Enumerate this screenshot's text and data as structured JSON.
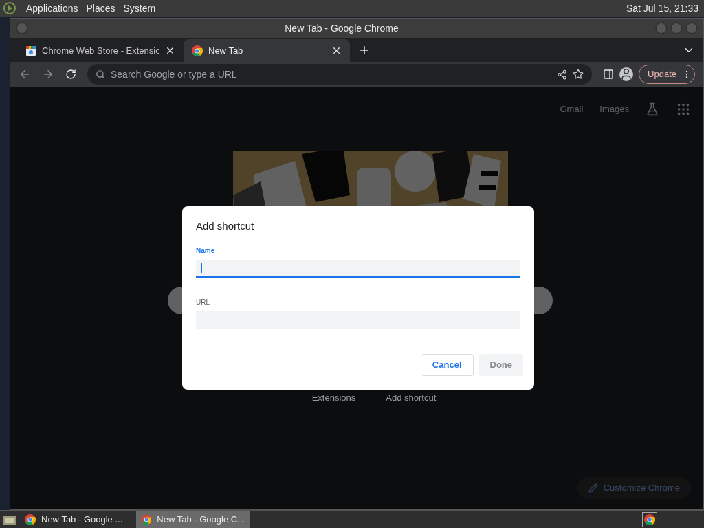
{
  "top_panel": {
    "menus": [
      "Applications",
      "Places",
      "System"
    ],
    "clock": "Sat Jul 15, 21:33"
  },
  "window": {
    "title": "New Tab - Google Chrome"
  },
  "tabs": [
    {
      "label": "Chrome Web Store - Extensio",
      "selected": false,
      "kind": "store"
    },
    {
      "label": "New Tab",
      "selected": true,
      "kind": "chrome"
    }
  ],
  "omnibox": {
    "placeholder": "Search Google or type a URL"
  },
  "update_button": "Update",
  "page": {
    "links": [
      "Gmail",
      "Images"
    ],
    "shortcut_labels": [
      "Extensions",
      "Add shortcut"
    ],
    "customize_button": "Customize Chrome"
  },
  "dialog": {
    "title": "Add shortcut",
    "fields": [
      {
        "label": "Name",
        "focused": true
      },
      {
        "label": "URL",
        "focused": false
      }
    ],
    "buttons": [
      {
        "label": "Cancel",
        "kind": "secondary"
      },
      {
        "label": "Done",
        "kind": "disabled"
      }
    ]
  },
  "taskbar": {
    "items": [
      {
        "label": "New Tab - Google ...",
        "selected": false
      },
      {
        "label": "New Tab - Google C...",
        "selected": true
      }
    ]
  }
}
